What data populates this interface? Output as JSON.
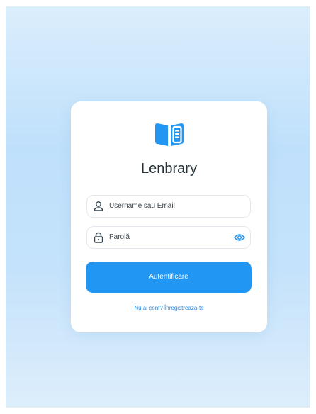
{
  "app": {
    "title": "Lenbrary",
    "logo_icon": "open-book-icon"
  },
  "login_form": {
    "username_placeholder": "Username sau Email",
    "password_placeholder": "Parolă",
    "username_icon": "user-icon",
    "password_icon": "lock-icon",
    "password_toggle_icon": "eye-icon",
    "submit_label": "Autentificare",
    "register_link": "Nu ai cont? Înregistrează-te"
  },
  "colors": {
    "accent": "#2196f3",
    "background_top": "#dbeefc",
    "background_mid": "#bfe0fb",
    "card": "#ffffff",
    "title_text": "#263238"
  }
}
